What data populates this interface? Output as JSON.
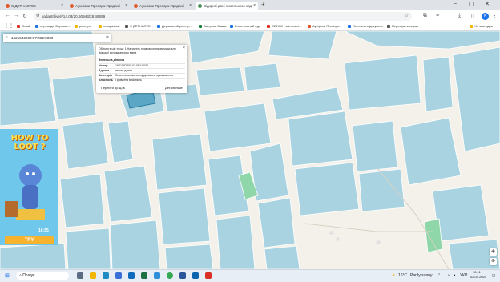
{
  "browser": {
    "tabs": [
      {
        "label": "Є ДЕТНАСТЕ9"
      },
      {
        "label": "Аукціони Прозоро.Продажі"
      },
      {
        "label": "Аукціони Прозоро.Продажі"
      },
      {
        "label": "Відкриті дані земельного кад",
        "active": true
      }
    ],
    "url": "kadastr.live/#14.03/20.60943/28.46699",
    "bookmarks": [
      {
        "label": "Gmail",
        "color": "#d93025"
      },
      {
        "label": "переводы Боровик...",
        "color": "#1a73e8"
      },
      {
        "label": "реєстри",
        "color": "#f2b600"
      },
      {
        "label": "нотаріалки",
        "color": "#f2b600"
      },
      {
        "label": "Є ДЕТНАСТЕ9",
        "color": "#555555"
      },
      {
        "label": "Державний реєстр...",
        "color": "#1a73e8"
      },
      {
        "label": "Америка бажає",
        "color": "#188038"
      },
      {
        "label": "Електронний суд",
        "color": "#1a73e8"
      },
      {
        "label": "СЕТАМ - звільнені...",
        "color": "#d93025"
      },
      {
        "label": "Аукціони Прозоро...",
        "color": "#e05a2a"
      },
      {
        "label": "Перевести документ",
        "color": "#1a73e8"
      },
      {
        "label": "Перевірити парав",
        "color": "#555555"
      }
    ],
    "all_bookmarks": "Усі закладки",
    "avatar_letter": "К"
  },
  "search": {
    "value": "1621582800:07:062:0039"
  },
  "popup": {
    "header": "Об'єкти в цій точці: 1 Натисніть правою кнопкою миші для фіксації всплываючого вікна",
    "section": "Земельна ділянка",
    "rows": [
      {
        "k": "Номер",
        "v": "1621582800:07:062:0039"
      },
      {
        "k": "Адреса",
        "v": "немає даних"
      },
      {
        "k": "Категорія",
        "v": "Землі сільськогосподарського призначення"
      },
      {
        "k": "Власність",
        "v": "Приватна власність"
      }
    ],
    "link_dzk": "Перейти до ДЗК",
    "details": "Детальніше"
  },
  "ad": {
    "title": "HOW TO LOOT ?",
    "try": "TRY",
    "countdown": "16:55"
  },
  "taskbar": {
    "search": "Пошук",
    "weather": "16°C",
    "weather_text": "Partly sunny",
    "language": "УКР",
    "time": "18:11",
    "date": "02.04.2024"
  },
  "colors": {
    "parcel_fill": "#a9d3e0",
    "parcel_stroke": "#ffffff",
    "parcel_highlight": "#8fd6a9",
    "map_bg": "#f3f1ea"
  }
}
